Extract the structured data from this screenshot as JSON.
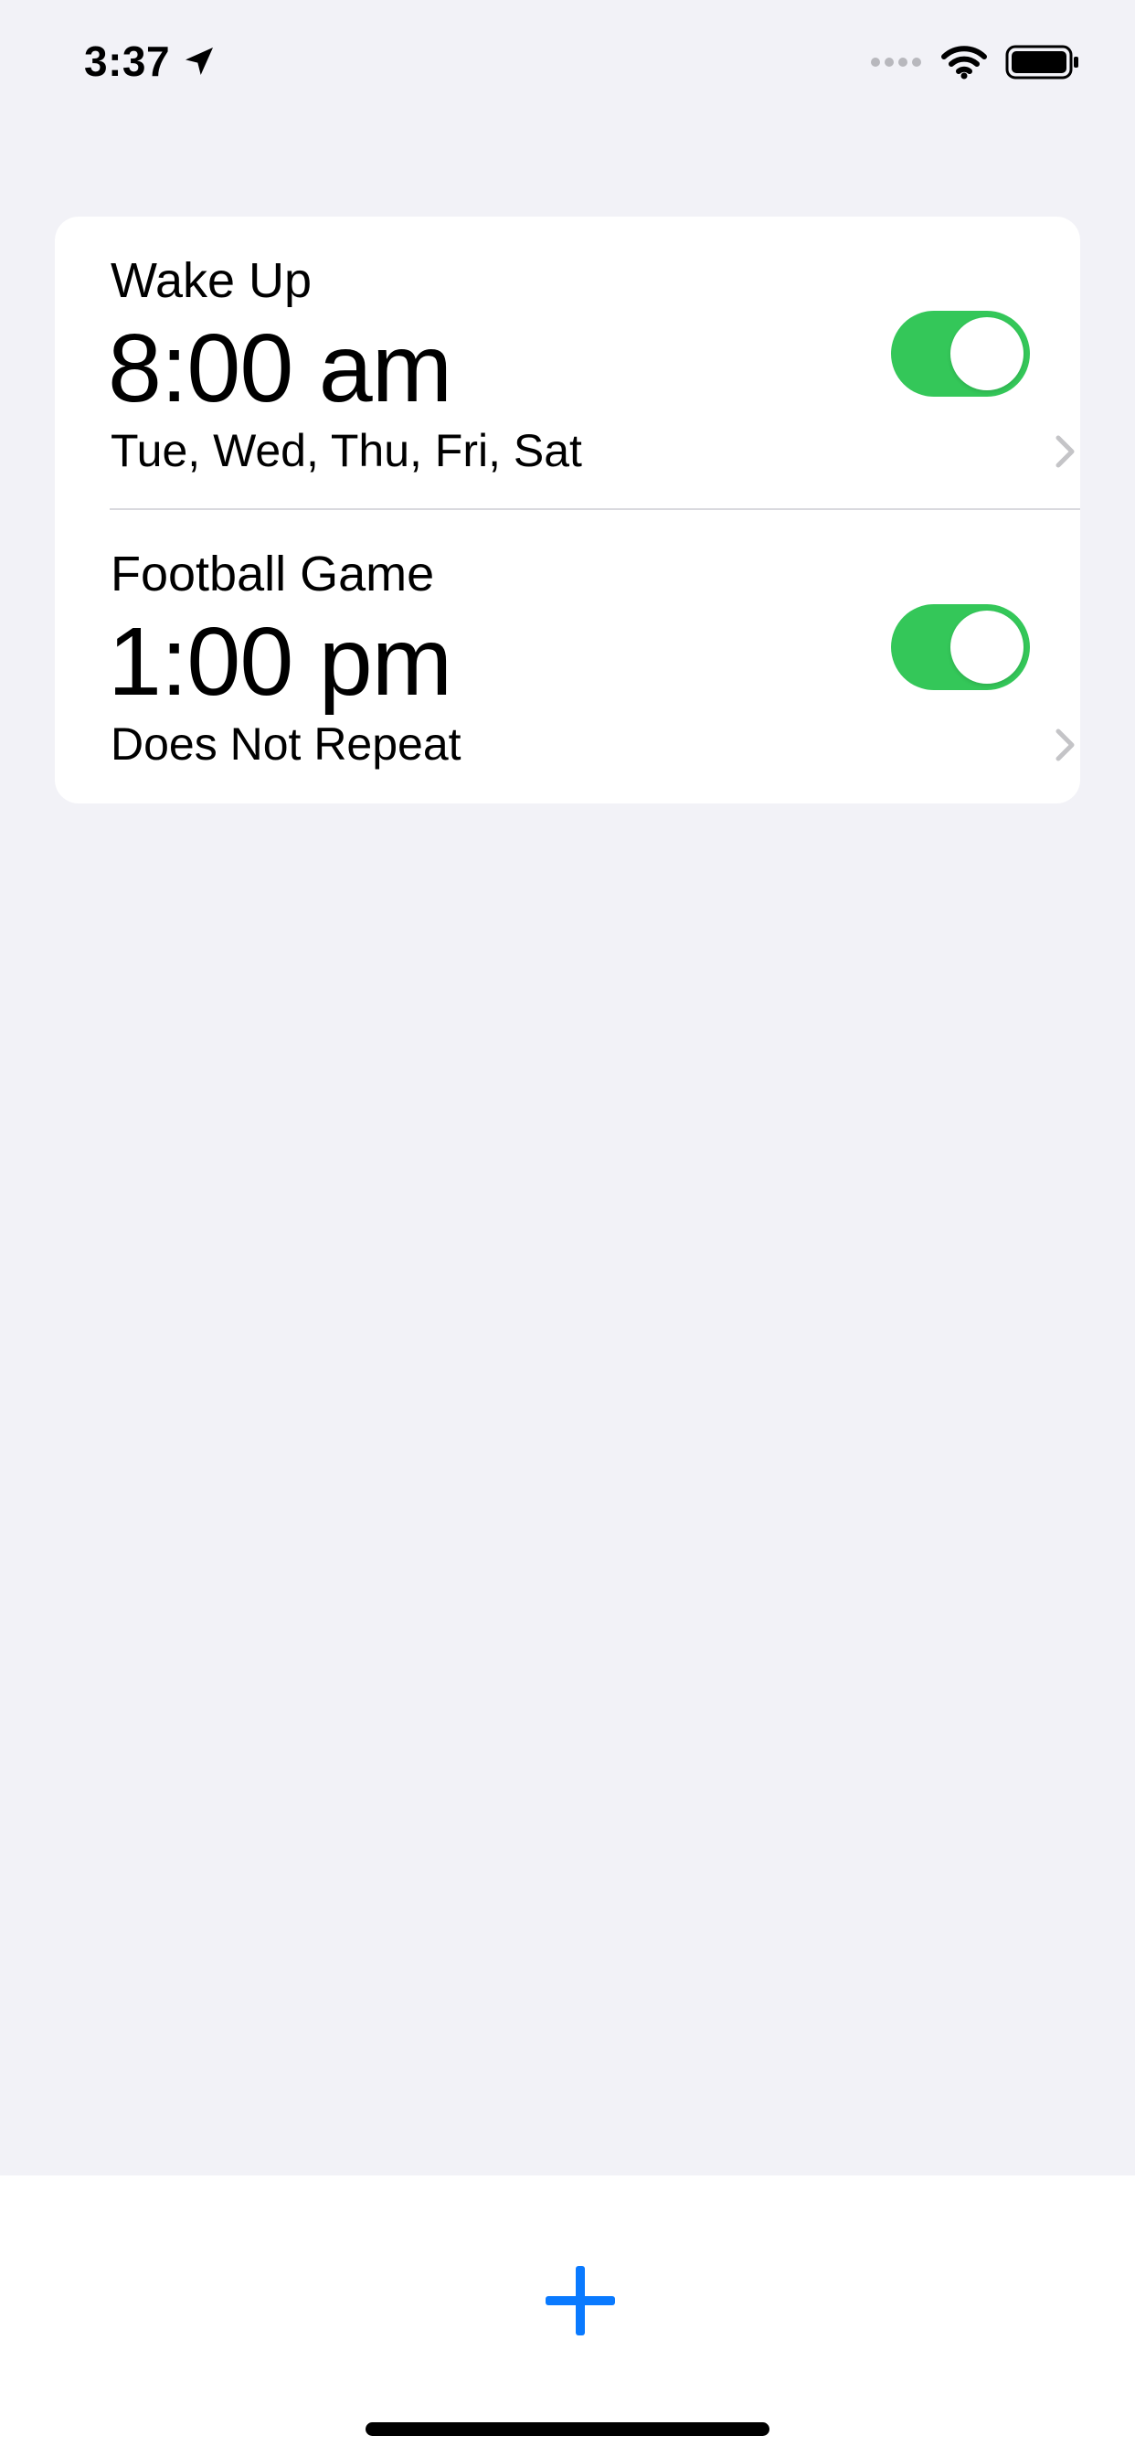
{
  "status_bar": {
    "time": "3:37",
    "icons": [
      "location-arrow-icon",
      "signal-dots-icon",
      "wifi-icon",
      "battery-icon"
    ]
  },
  "alarms": [
    {
      "label": "Wake Up",
      "time": "8:00 am",
      "repeat": "Tue, Wed, Thu, Fri, Sat",
      "enabled": true
    },
    {
      "label": "Football Game",
      "time": "1:00 pm",
      "repeat": "Does Not Repeat",
      "enabled": true
    }
  ],
  "toolbar": {
    "add_icon": "plus-icon"
  },
  "colors": {
    "background": "#f2f2f7",
    "card": "#ffffff",
    "toggle_on": "#34c759",
    "accent": "#0a7aff",
    "chevron": "#c4c4c7"
  }
}
